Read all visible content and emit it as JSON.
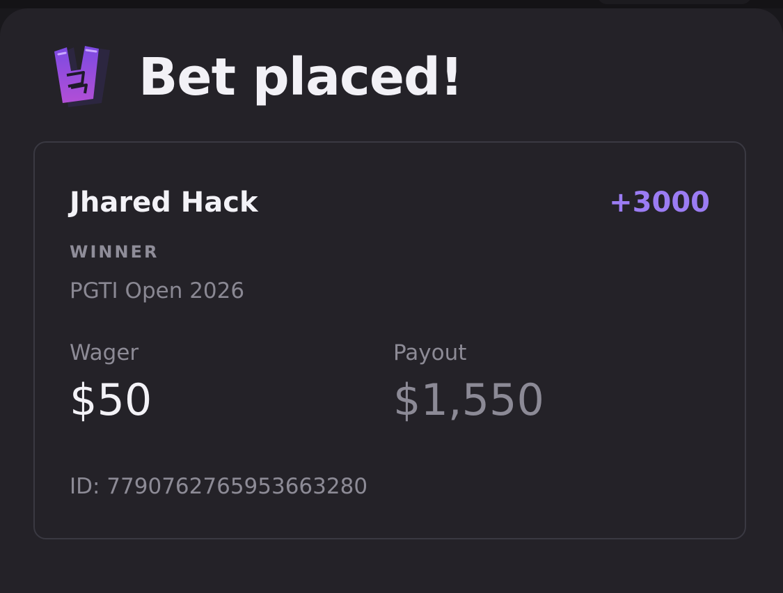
{
  "header": {
    "title": "Bet placed!",
    "logo_icon": "rock-hand-icon",
    "logo_colors": [
      "#7b4ae2",
      "#b24fd6",
      "#2c2640"
    ]
  },
  "bet": {
    "selection": "Jhared Hack",
    "odds": "+3000",
    "market": "WINNER",
    "event": "PGTI Open 2026",
    "wager_label": "Wager",
    "wager_value": "$50",
    "payout_label": "Payout",
    "payout_value": "$1,550",
    "id_text": "ID: 7790762765953663280"
  },
  "colors": {
    "accent": "#9b7cf3",
    "background": "#242228",
    "text_primary": "#f3f2f7",
    "text_secondary": "#8d8b96",
    "card_border": "#3a3942"
  }
}
